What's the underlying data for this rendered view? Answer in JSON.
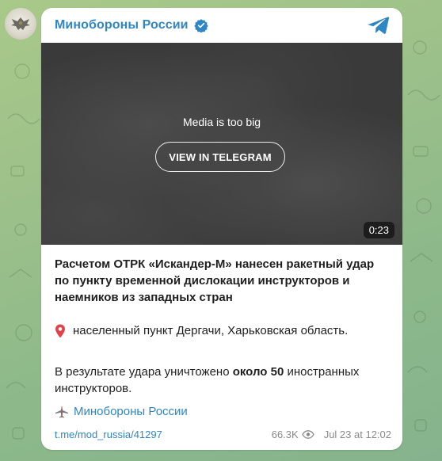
{
  "channel": {
    "name": "Минобороны России",
    "verified_icon": "verified-badge-icon",
    "platform_icon": "telegram-plane-icon",
    "accent_color": "#2f86c4"
  },
  "media": {
    "message": "Media is too big",
    "button_label": "VIEW IN TELEGRAM",
    "duration": "0:23"
  },
  "post": {
    "title": "Расчетом ОТРК «Искандер-М» нанесен ракетный удар по пункту временной дислокации инструкторов и наемников из западных стран",
    "location_icon": "pin-icon",
    "location_text": "населенный пункт Дергачи, Харьковская область.",
    "result_prefix": "В результате удара уничтожено ",
    "result_bold": "около 50",
    "result_suffix": " иностранных инструкторов.",
    "signature": "Минобороны России",
    "signature_icon": "aircraft-icon"
  },
  "footer": {
    "link": "t.me/mod_russia/41297",
    "views": "66.3K",
    "views_icon": "eye-icon",
    "date": "Jul 23 at 12:02"
  }
}
